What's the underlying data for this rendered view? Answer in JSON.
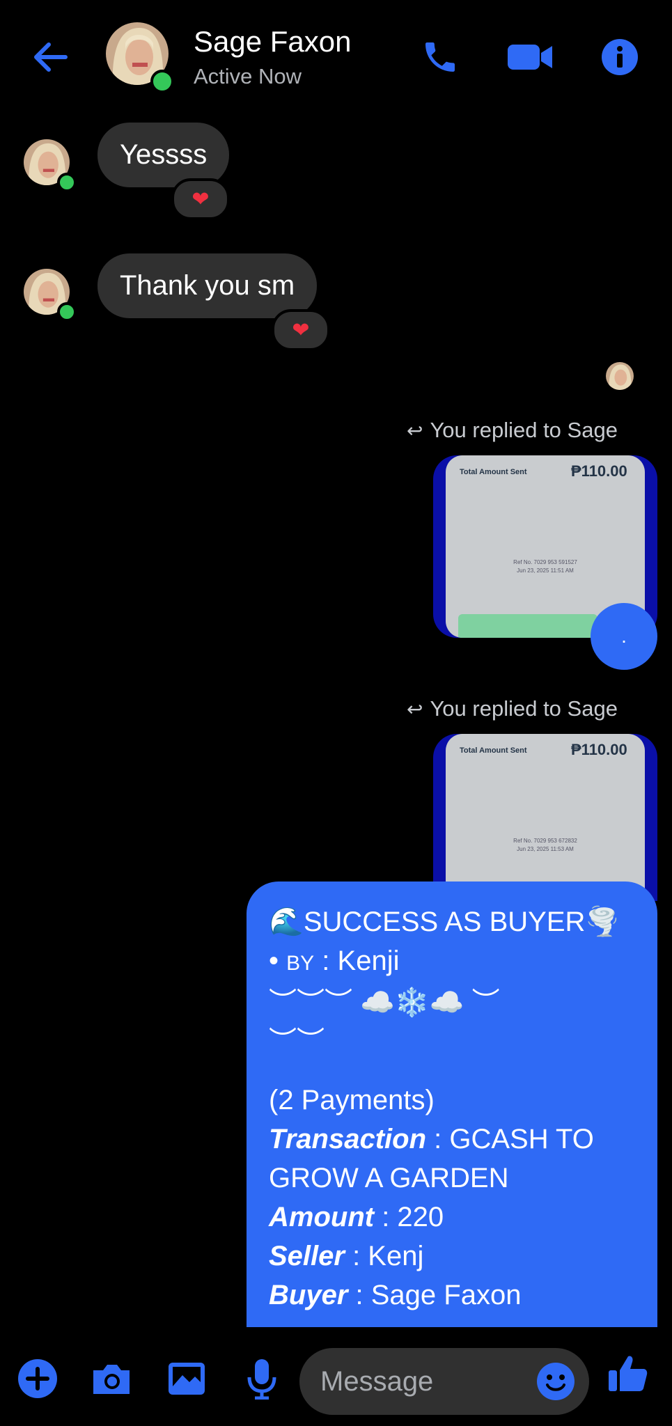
{
  "header": {
    "name": "Sage Faxon",
    "status": "Active Now",
    "accent": "#2f6af5"
  },
  "messages": {
    "incoming": [
      {
        "text": "Yessss",
        "reaction": "heart"
      },
      {
        "text": "Thank you sm",
        "reaction": "heart"
      }
    ],
    "replies": [
      {
        "label": "You replied to Sage",
        "receipt_title": "Total Amount Sent",
        "receipt_amount": "₱110.00",
        "ref_line1": "Ref No. 7029 953 591527",
        "ref_line2": "Jun 23, 2025 11:51 AM"
      },
      {
        "label": "You replied to Sage",
        "receipt_title": "Total Amount Sent",
        "receipt_amount": "₱110.00",
        "ref_line1": "Ref No. 7029 953 672832",
        "ref_line2": "Jun 23, 2025 11:53 AM"
      }
    ],
    "dot_message": ".",
    "outgoing_card": {
      "line1_emoji_left": "🌊",
      "line1_text": "SUCCESS AS BUYER",
      "line1_emoji_right": "🌪️",
      "by_bullet": "•",
      "by_label": "BY",
      "by_value": ": Kenji",
      "decor_line1": "︶︶︶ ☁️❄️☁️ ︶",
      "decor_line2": "︶︶",
      "payments": "(2 Payments)",
      "transaction_label": "Transaction",
      "transaction_value": " : GCASH TO GROW A GARDEN",
      "amount_label": "Amount",
      "amount_value": " : 220",
      "seller_label": "Seller",
      "seller_value": " : Kenj",
      "buyer_label": "Buyer",
      "buyer_value": " : Sage Faxon"
    }
  },
  "composer": {
    "placeholder": "Message"
  }
}
